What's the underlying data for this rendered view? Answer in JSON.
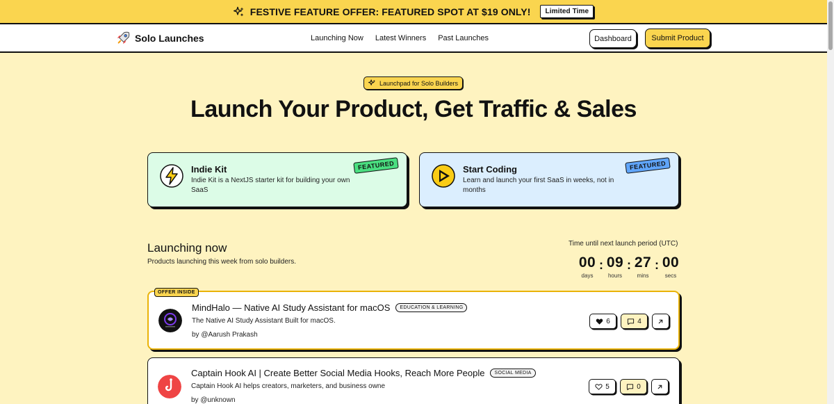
{
  "promo": {
    "text": "FESTIVE FEATURE OFFER: FEATURED SPOT AT $19 ONLY!",
    "badge": "Limited Time"
  },
  "nav": {
    "brand": "Solo Launches",
    "links": [
      "Launching Now",
      "Latest Winners",
      "Past Launches"
    ],
    "dashboard": "Dashboard",
    "submit": "Submit Product"
  },
  "hero": {
    "pill": "Launchpad for Solo Builders",
    "title": "Launch Your Product, Get Traffic & Sales"
  },
  "featured": [
    {
      "title": "Indie Kit",
      "description": "Indie Kit is a NextJS starter kit for building your own SaaS",
      "badge": "FEATURED",
      "icon": "lightning-icon"
    },
    {
      "title": "Start Coding",
      "description": "Learn and launch your first SaaS in weeks, not in months",
      "badge": "FEATURED",
      "icon": "play-icon"
    }
  ],
  "section": {
    "title": "Launching now",
    "subtitle": "Products launching this week from solo builders."
  },
  "countdown": {
    "label": "Time until next launch period (UTC)",
    "days": "00",
    "hours": "09",
    "mins": "27",
    "secs": "00",
    "days_label": "days",
    "hours_label": "hours",
    "mins_label": "mins",
    "secs_label": "secs",
    "separator": ":"
  },
  "products": [
    {
      "offer_tag": "OFFER INSIDE",
      "name": "MindHalo — Native AI Study Assistant for macOS",
      "category": "EDUCATION & LEARNING",
      "description": "The Native AI Study Assistant Built for macOS.",
      "by": "by @Aarush Prakash",
      "upvotes": "6",
      "comments": "4"
    },
    {
      "name": "Captain Hook AI | Create Better Social Media Hooks, Reach More People",
      "category": "SOCIAL MEDIA",
      "description": "Captain Hook AI helps creators, marketers, and business owne",
      "by": "by @unknown",
      "upvotes": "5",
      "comments": "0"
    }
  ],
  "colors": {
    "background": "#fef3c0",
    "accent": "#fad54f",
    "ink": "#111111",
    "featured_green": "#dcfce7",
    "featured_blue": "#dbeefe"
  }
}
